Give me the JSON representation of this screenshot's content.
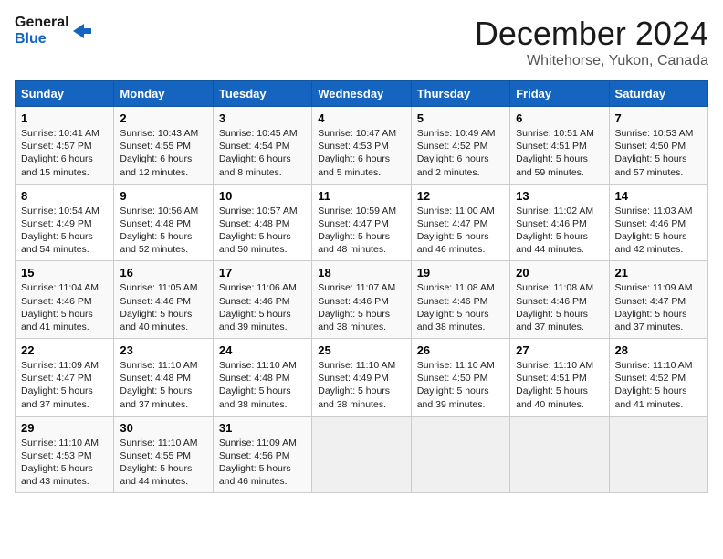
{
  "header": {
    "logo_line1": "General",
    "logo_line2": "Blue",
    "month": "December 2024",
    "location": "Whitehorse, Yukon, Canada"
  },
  "days_of_week": [
    "Sunday",
    "Monday",
    "Tuesday",
    "Wednesday",
    "Thursday",
    "Friday",
    "Saturday"
  ],
  "weeks": [
    [
      {
        "day": "1",
        "sunrise": "10:41 AM",
        "sunset": "4:57 PM",
        "daylight": "6 hours and 15 minutes."
      },
      {
        "day": "2",
        "sunrise": "10:43 AM",
        "sunset": "4:55 PM",
        "daylight": "6 hours and 12 minutes."
      },
      {
        "day": "3",
        "sunrise": "10:45 AM",
        "sunset": "4:54 PM",
        "daylight": "6 hours and 8 minutes."
      },
      {
        "day": "4",
        "sunrise": "10:47 AM",
        "sunset": "4:53 PM",
        "daylight": "6 hours and 5 minutes."
      },
      {
        "day": "5",
        "sunrise": "10:49 AM",
        "sunset": "4:52 PM",
        "daylight": "6 hours and 2 minutes."
      },
      {
        "day": "6",
        "sunrise": "10:51 AM",
        "sunset": "4:51 PM",
        "daylight": "5 hours and 59 minutes."
      },
      {
        "day": "7",
        "sunrise": "10:53 AM",
        "sunset": "4:50 PM",
        "daylight": "5 hours and 57 minutes."
      }
    ],
    [
      {
        "day": "8",
        "sunrise": "10:54 AM",
        "sunset": "4:49 PM",
        "daylight": "5 hours and 54 minutes."
      },
      {
        "day": "9",
        "sunrise": "10:56 AM",
        "sunset": "4:48 PM",
        "daylight": "5 hours and 52 minutes."
      },
      {
        "day": "10",
        "sunrise": "10:57 AM",
        "sunset": "4:48 PM",
        "daylight": "5 hours and 50 minutes."
      },
      {
        "day": "11",
        "sunrise": "10:59 AM",
        "sunset": "4:47 PM",
        "daylight": "5 hours and 48 minutes."
      },
      {
        "day": "12",
        "sunrise": "11:00 AM",
        "sunset": "4:47 PM",
        "daylight": "5 hours and 46 minutes."
      },
      {
        "day": "13",
        "sunrise": "11:02 AM",
        "sunset": "4:46 PM",
        "daylight": "5 hours and 44 minutes."
      },
      {
        "day": "14",
        "sunrise": "11:03 AM",
        "sunset": "4:46 PM",
        "daylight": "5 hours and 42 minutes."
      }
    ],
    [
      {
        "day": "15",
        "sunrise": "11:04 AM",
        "sunset": "4:46 PM",
        "daylight": "5 hours and 41 minutes."
      },
      {
        "day": "16",
        "sunrise": "11:05 AM",
        "sunset": "4:46 PM",
        "daylight": "5 hours and 40 minutes."
      },
      {
        "day": "17",
        "sunrise": "11:06 AM",
        "sunset": "4:46 PM",
        "daylight": "5 hours and 39 minutes."
      },
      {
        "day": "18",
        "sunrise": "11:07 AM",
        "sunset": "4:46 PM",
        "daylight": "5 hours and 38 minutes."
      },
      {
        "day": "19",
        "sunrise": "11:08 AM",
        "sunset": "4:46 PM",
        "daylight": "5 hours and 38 minutes."
      },
      {
        "day": "20",
        "sunrise": "11:08 AM",
        "sunset": "4:46 PM",
        "daylight": "5 hours and 37 minutes."
      },
      {
        "day": "21",
        "sunrise": "11:09 AM",
        "sunset": "4:47 PM",
        "daylight": "5 hours and 37 minutes."
      }
    ],
    [
      {
        "day": "22",
        "sunrise": "11:09 AM",
        "sunset": "4:47 PM",
        "daylight": "5 hours and 37 minutes."
      },
      {
        "day": "23",
        "sunrise": "11:10 AM",
        "sunset": "4:48 PM",
        "daylight": "5 hours and 37 minutes."
      },
      {
        "day": "24",
        "sunrise": "11:10 AM",
        "sunset": "4:48 PM",
        "daylight": "5 hours and 38 minutes."
      },
      {
        "day": "25",
        "sunrise": "11:10 AM",
        "sunset": "4:49 PM",
        "daylight": "5 hours and 38 minutes."
      },
      {
        "day": "26",
        "sunrise": "11:10 AM",
        "sunset": "4:50 PM",
        "daylight": "5 hours and 39 minutes."
      },
      {
        "day": "27",
        "sunrise": "11:10 AM",
        "sunset": "4:51 PM",
        "daylight": "5 hours and 40 minutes."
      },
      {
        "day": "28",
        "sunrise": "11:10 AM",
        "sunset": "4:52 PM",
        "daylight": "5 hours and 41 minutes."
      }
    ],
    [
      {
        "day": "29",
        "sunrise": "11:10 AM",
        "sunset": "4:53 PM",
        "daylight": "5 hours and 43 minutes."
      },
      {
        "day": "30",
        "sunrise": "11:10 AM",
        "sunset": "4:55 PM",
        "daylight": "5 hours and 44 minutes."
      },
      {
        "day": "31",
        "sunrise": "11:09 AM",
        "sunset": "4:56 PM",
        "daylight": "5 hours and 46 minutes."
      },
      null,
      null,
      null,
      null
    ]
  ]
}
